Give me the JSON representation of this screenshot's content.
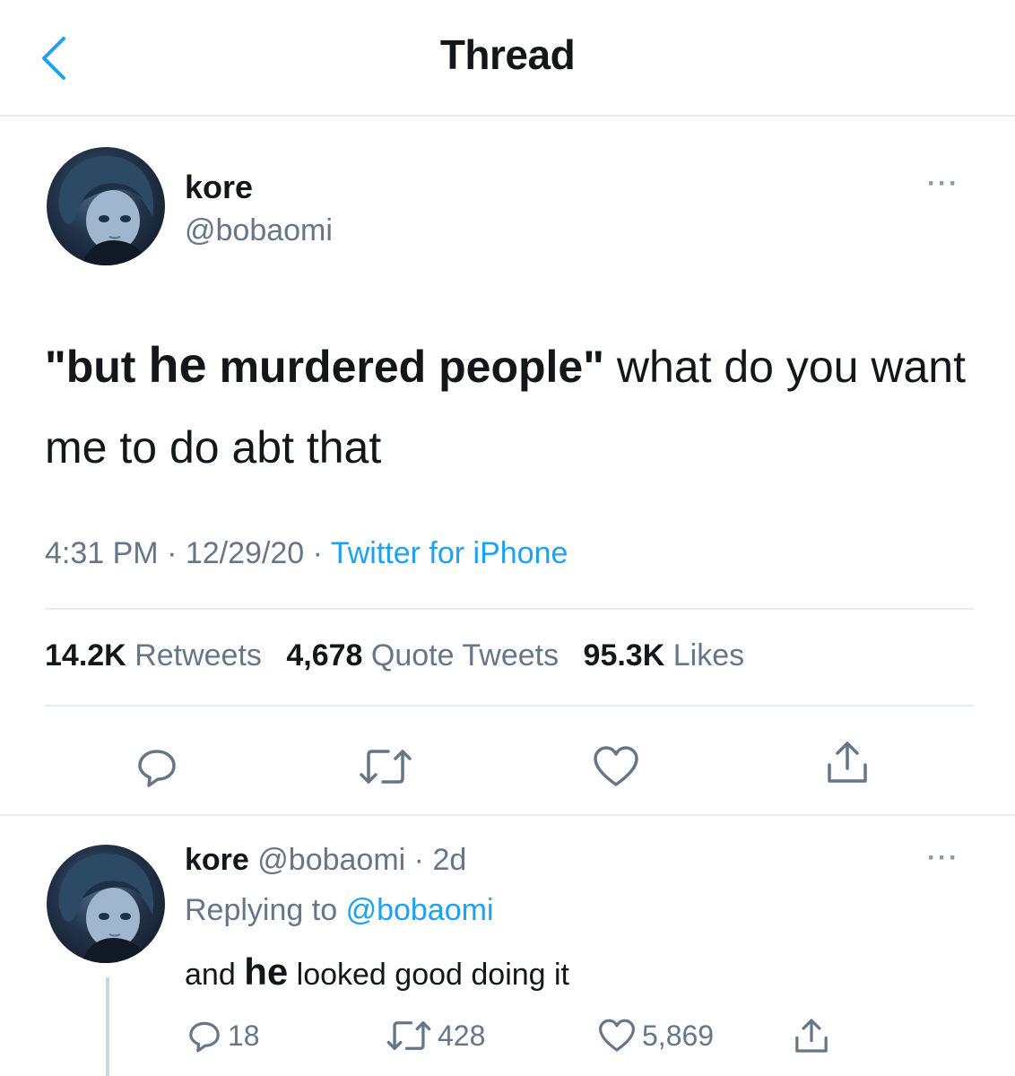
{
  "header": {
    "title": "Thread"
  },
  "main_tweet": {
    "name": "kore",
    "handle": "@bobaomi",
    "text_parts": {
      "open_quote_but": "\"but ",
      "he": "he",
      "murdered_people": " murdered people\"",
      "rest": " what do you want me to do abt that"
    },
    "time": "4:31 PM",
    "date": "12/29/20",
    "source": "Twitter for iPhone",
    "sep": "·",
    "stats": {
      "retweets_count": "14.2K",
      "retweets_label": "Retweets",
      "quotes_count": "4,678",
      "quotes_label": "Quote Tweets",
      "likes_count": "95.3K",
      "likes_label": "Likes"
    }
  },
  "reply": {
    "name": "kore",
    "handle": "@bobaomi",
    "age": "2d",
    "sep": "·",
    "replying_label": "Replying to",
    "replying_handle": "@bobaomi",
    "text_parts": {
      "and": "and ",
      "he": "he",
      "rest": " looked good doing it"
    },
    "replies": "18",
    "retweets": "428",
    "likes": "5,869"
  },
  "icons": {
    "back": "chevron-left-icon",
    "more": "more-horizontal-icon",
    "reply": "reply-bubble-icon",
    "retweet": "retweet-icon",
    "like": "heart-icon",
    "share": "share-icon"
  },
  "colors": {
    "accent": "#1da1f2",
    "text": "#14171a",
    "muted": "#657786",
    "divider": "#e6ecf0"
  }
}
